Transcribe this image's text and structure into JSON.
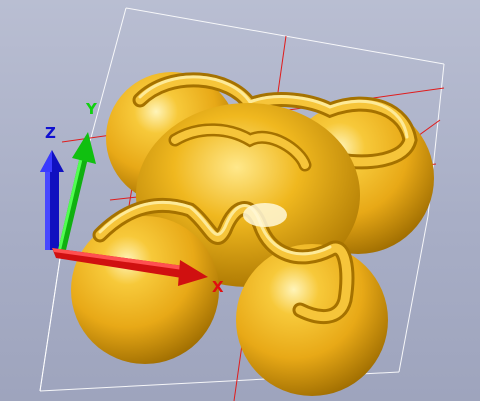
{
  "viewport": {
    "background": "#a8aec6",
    "model_color": "#f2b81e",
    "model_highlight": "#fff3b0",
    "model_shadow": "#9c6d00",
    "bounding_box_color": "#ffffff",
    "grid_color": "#e01c1c"
  },
  "axes": {
    "x": {
      "label": "X",
      "color": "#e01010",
      "icon": "x-axis-arrow"
    },
    "y": {
      "label": "Y",
      "color": "#10d010",
      "icon": "y-axis-arrow"
    },
    "z": {
      "label": "Z",
      "color": "#1010d0",
      "icon": "z-axis-arrow"
    }
  }
}
